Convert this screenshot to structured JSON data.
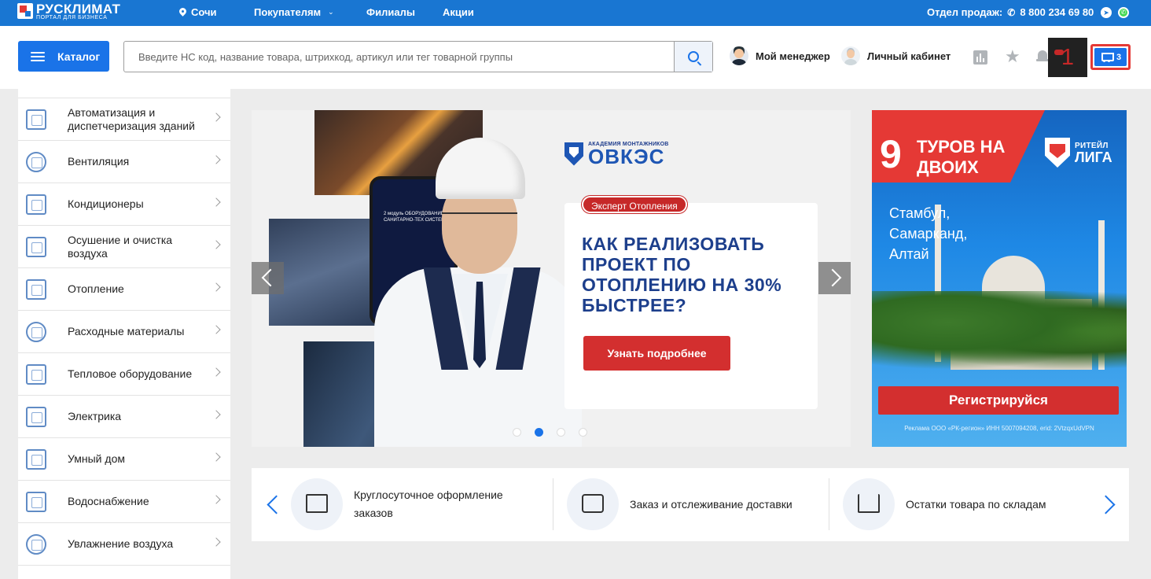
{
  "topbar": {
    "logo_name": "РУСКЛИМАТ",
    "logo_sub": "ПОРТАЛ ДЛЯ БИЗНЕСА",
    "city": "Сочи",
    "nav": [
      "Покупателям",
      "Филиалы",
      "Акции"
    ],
    "sales_label": "Отдел продаж:",
    "phone": "8 800 234 69 80"
  },
  "header": {
    "catalog_label": "Каталог",
    "search_placeholder": "Введите НС код, название товара, штрихкод, артикул или тег товарной группы",
    "manager_label": "Мой менеджер",
    "cabinet_label": "Личный кабинет",
    "overlay_number": "1",
    "cart_count": "3"
  },
  "sidebar": {
    "items": [
      {
        "label": "Автоматизация и диспетчеризация зданий",
        "icon": "building-automation-icon"
      },
      {
        "label": "Вентиляция",
        "icon": "ventilation-icon"
      },
      {
        "label": "Кондиционеры",
        "icon": "air-conditioner-icon"
      },
      {
        "label": "Осушение и очистка воздуха",
        "icon": "dehumidifier-icon"
      },
      {
        "label": "Отопление",
        "icon": "radiator-icon"
      },
      {
        "label": "Расходные материалы",
        "icon": "consumables-icon"
      },
      {
        "label": "Тепловое оборудование",
        "icon": "heater-icon"
      },
      {
        "label": "Электрика",
        "icon": "electrical-icon"
      },
      {
        "label": "Умный дом",
        "icon": "smart-home-icon"
      },
      {
        "label": "Водоснабжение",
        "icon": "water-supply-icon"
      },
      {
        "label": "Увлажнение воздуха",
        "icon": "humidifier-icon"
      }
    ]
  },
  "banner": {
    "academy_sub": "АКАДЕМИЯ МОНТАЖНИКОВ",
    "academy_name": "ОВКЭС",
    "expert_badge": "Эксперт Отопления",
    "headline": "КАК РЕАЛИЗОВАТЬ ПРОЕКТ ПО ОТОПЛЕНИЮ НА 30% БЫСТРЕЕ?",
    "button": "Узнать подробнее",
    "phone_text": "2 модуль ОБОРУДОВАНИЕ САНИТАРНО-ТЕХ СИСТЕМ",
    "active_slide": 2,
    "slide_count": 4
  },
  "ad": {
    "number": "9",
    "title": "ТУРОВ НА ДВОИХ",
    "brand_small": "РИТЕЙЛ",
    "brand_large": "ЛИГА",
    "cities": [
      "Стамбул,",
      "Самарканд,",
      "Алтай"
    ],
    "button": "Регистрируйся",
    "note": "Реклама ООО «РК-регион» ИНН 5007094208, erid: 2VtzqxUdVPN"
  },
  "features": [
    {
      "text": "Круглосуточное оформление заказов",
      "icon": "store-icon"
    },
    {
      "text": "Заказ и отслеживание доставки",
      "icon": "delivery-truck-icon"
    },
    {
      "text": "Остатки товара по складам",
      "icon": "cart-icon"
    }
  ],
  "colors": {
    "brand_blue": "#1976d2",
    "accent_red": "#d32f2f",
    "heading_blue": "#1d3f8c"
  }
}
